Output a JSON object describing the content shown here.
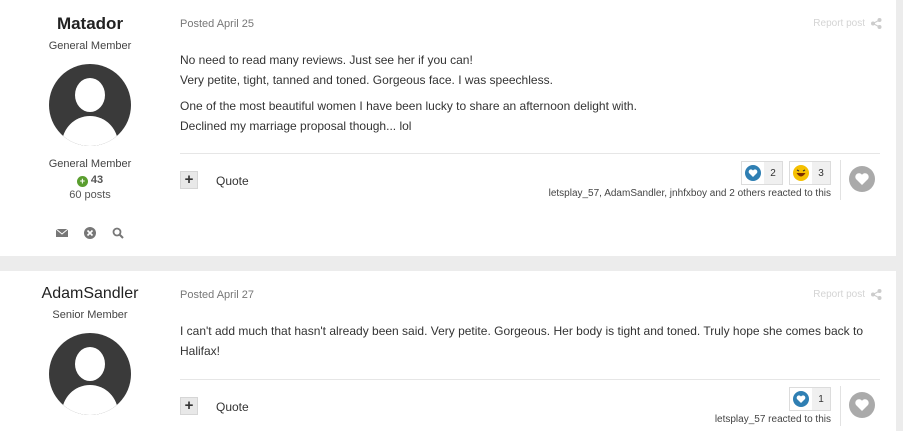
{
  "posts": [
    {
      "author": "Matador",
      "title": "General Member",
      "group": "General Member",
      "reputation": "43",
      "post_count": "60 posts",
      "date": "Posted April 25",
      "report_label": "Report post",
      "paragraphs": [
        "No need to read many reviews. Just see her if you can!",
        "Very petite, tight, tanned and toned. Gorgeous face. I was speechless.",
        "One of the most beautiful women I have been lucky to share an afternoon delight with.",
        "Declined my marriage proposal though... lol"
      ],
      "quote_label": "Quote",
      "reactions": [
        {
          "icon": "like-heart-icon",
          "count": "2"
        },
        {
          "icon": "haha-emoji-icon",
          "count": "3"
        }
      ],
      "reacted_text": "letsplay_57, AdamSandler, jnhfxboy and 2 others reacted to this"
    },
    {
      "author": "AdamSandler",
      "title": "Senior Member",
      "date": "Posted April 27",
      "report_label": "Report post",
      "paragraphs": [
        "I can't add much that hasn't already been said. Very petite. Gorgeous. Her body is tight and toned. Truly hope she comes back to Halifax!"
      ],
      "quote_label": "Quote",
      "reactions": [
        {
          "icon": "like-heart-icon",
          "count": "1"
        }
      ],
      "reacted_text": "letsplay_57 reacted to this"
    }
  ],
  "colors": {
    "reputation_green": "#5a9e2f",
    "like_blue": "#2f7fb3",
    "avatar_gray": "#3a3a3a"
  }
}
